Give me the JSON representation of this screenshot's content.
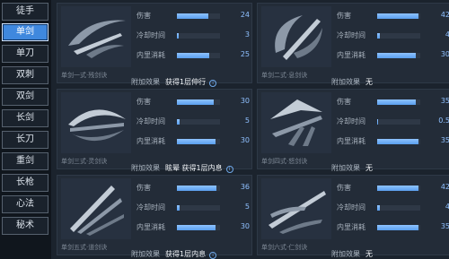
{
  "sidebar": {
    "items": [
      {
        "label": "徒手"
      },
      {
        "label": "单剑"
      },
      {
        "label": "单刀"
      },
      {
        "label": "双刺"
      },
      {
        "label": "双剑"
      },
      {
        "label": "长剑"
      },
      {
        "label": "长刀"
      },
      {
        "label": "重剑"
      },
      {
        "label": "长枪"
      },
      {
        "label": "心法"
      },
      {
        "label": "秘术"
      }
    ],
    "active_index": 1
  },
  "labels": {
    "damage": "伤害",
    "cooldown": "冷却时间",
    "mana": "内里消耗",
    "effect": "附加效果"
  },
  "cards": [
    {
      "name": "单剑一式·残剑诀",
      "damage": "24",
      "damage_level": 0.72,
      "cooldown": "3",
      "cooldown_level": 0.05,
      "mana": "25",
      "mana_level": 0.75,
      "effect": "获得1层伸行",
      "has_info": true
    },
    {
      "name": "单剑二式·息剑诀",
      "damage": "42",
      "damage_level": 0.95,
      "cooldown": "4",
      "cooldown_level": 0.06,
      "mana": "30",
      "mana_level": 0.9,
      "effect": "无",
      "has_info": false
    },
    {
      "name": "单剑三式·灵剑诀",
      "damage": "30",
      "damage_level": 0.85,
      "cooldown": "5",
      "cooldown_level": 0.06,
      "mana": "30",
      "mana_level": 0.9,
      "effect": "眩晕 获得1层内息",
      "has_info": true
    },
    {
      "name": "单剑四式·怒剑诀",
      "damage": "35",
      "damage_level": 0.9,
      "cooldown": "0.5",
      "cooldown_level": 0.03,
      "mana": "35",
      "mana_level": 0.95,
      "effect": "无",
      "has_info": false
    },
    {
      "name": "单剑五式·道剑诀",
      "damage": "36",
      "damage_level": 0.92,
      "cooldown": "5",
      "cooldown_level": 0.06,
      "mana": "30",
      "mana_level": 0.9,
      "effect": "获得1层内息",
      "has_info": true
    },
    {
      "name": "单剑六式·仁剑诀",
      "damage": "42",
      "damage_level": 0.95,
      "cooldown": "4",
      "cooldown_level": 0.06,
      "mana": "35",
      "mana_level": 0.95,
      "effect": "无",
      "has_info": false
    }
  ],
  "colors": {
    "accent": "#3f88de",
    "bar": "#6fb0ff",
    "value": "#8fc0ff"
  }
}
